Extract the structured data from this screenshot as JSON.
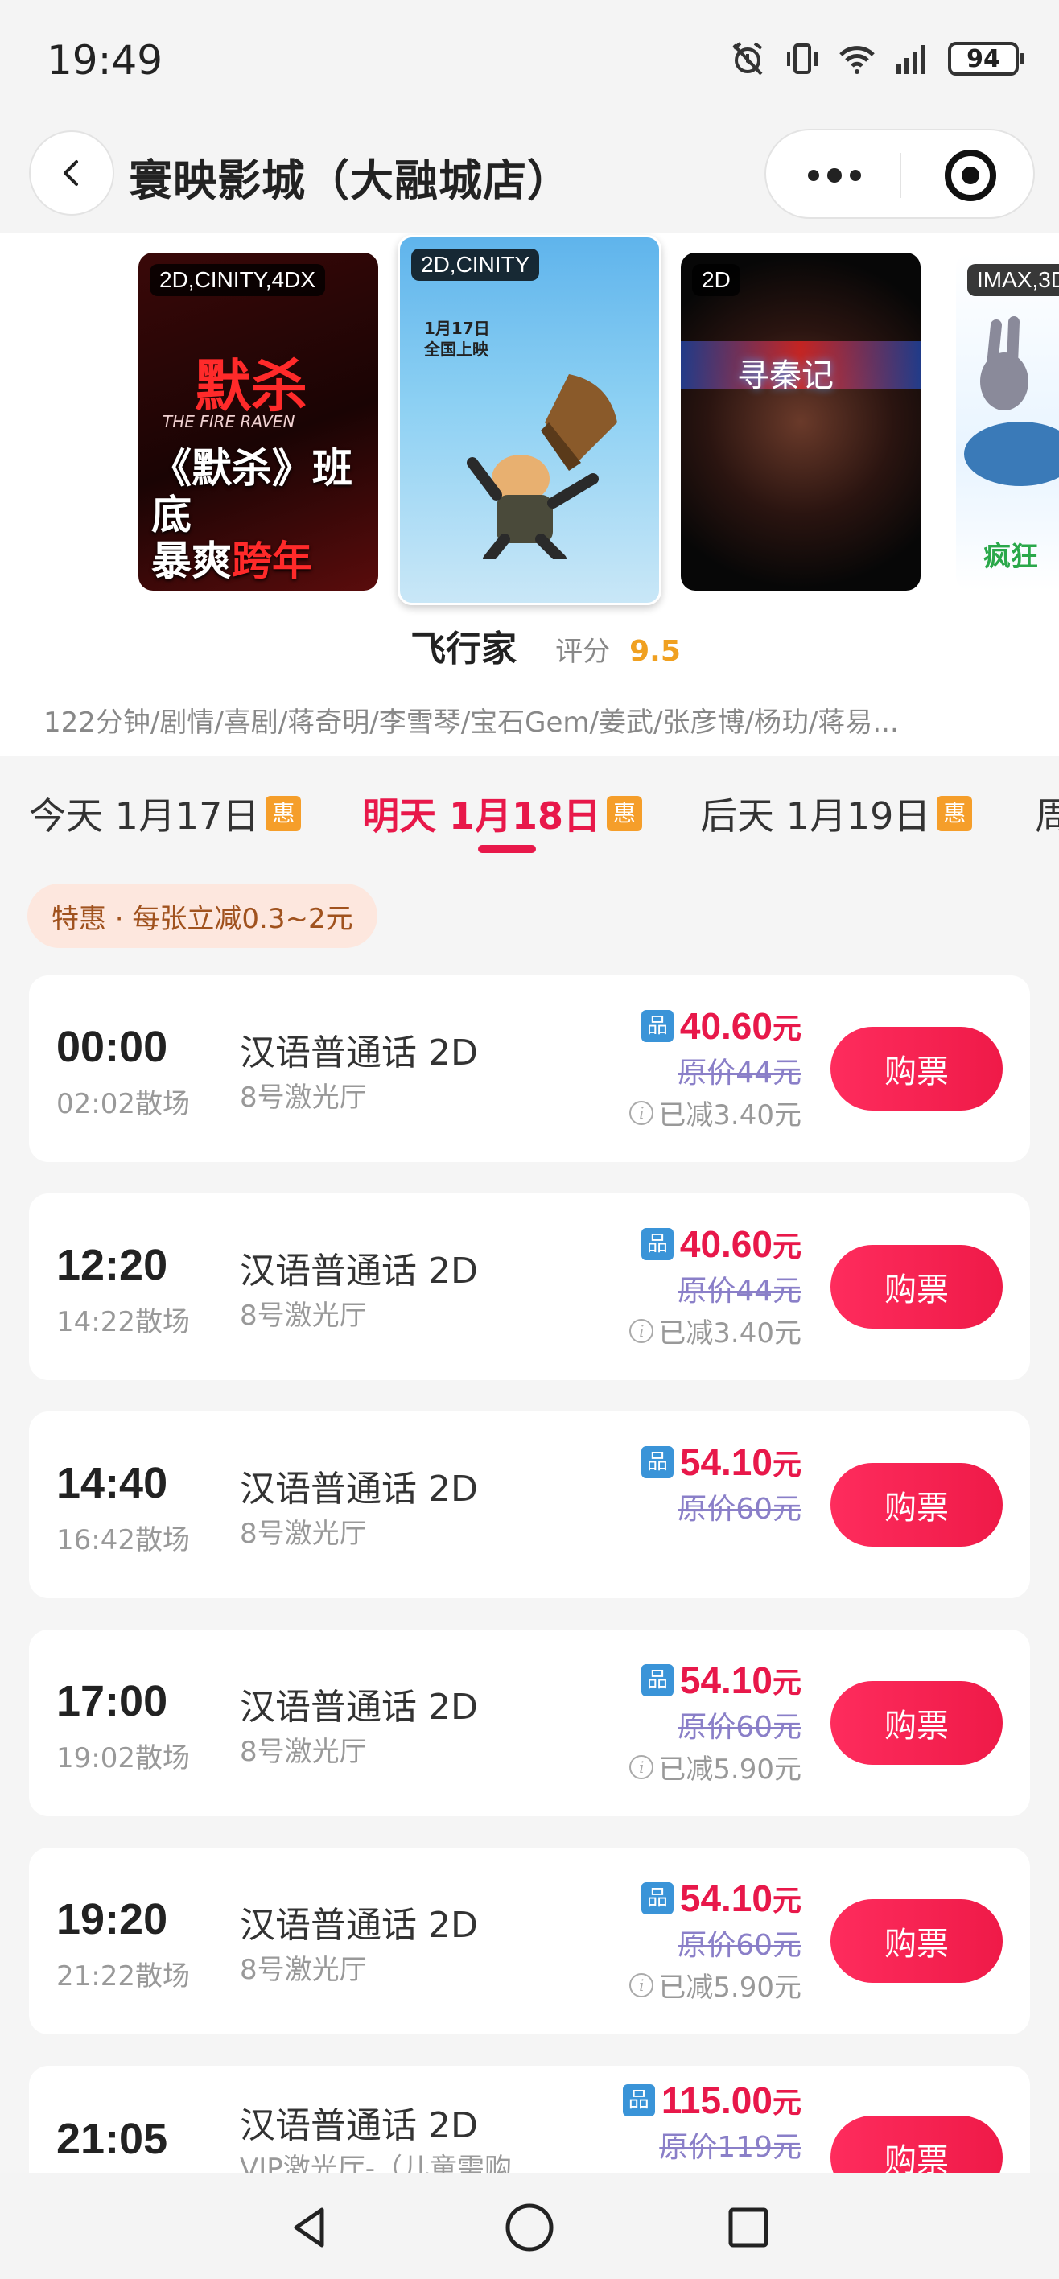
{
  "status_bar": {
    "time": "19:49",
    "battery": "94",
    "icons": [
      "alarm-icon",
      "vibrate-icon",
      "wifi-icon",
      "signal-icon",
      "battery-icon"
    ]
  },
  "header": {
    "title": "寰映影城（大融城店）",
    "back_icon": "chevron-left-icon",
    "more_icon": "more-dots-icon",
    "close_icon": "target-close-icon"
  },
  "posters": [
    {
      "tag": "2D,CINITY,4DX",
      "line1": "《默杀》班底",
      "line2a": "暴爽",
      "line2b": "跨年",
      "logo": "默杀",
      "subtitle": "THE FIRE RAVEN"
    },
    {
      "tag": "2D,CINITY",
      "date_line1": "1月17日",
      "date_line2": "全国上映"
    },
    {
      "tag": "2D",
      "title": "寻秦记"
    },
    {
      "tag": "IMAX,3D",
      "title": "疯狂"
    }
  ],
  "movie": {
    "title": "飞行家",
    "score_label": "评分",
    "score": "9.5",
    "meta": "122分钟/剧情/喜剧/蒋奇明/李雪琴/宝石Gem/姜武/张彦博/杨玏/蒋易..."
  },
  "date_tabs": [
    {
      "label": "今天 1月17日",
      "badge": "惠",
      "active": false
    },
    {
      "label": "明天 1月18日",
      "badge": "惠",
      "active": true
    },
    {
      "label": "后天 1月19日",
      "badge": "惠",
      "active": false
    },
    {
      "label": "周",
      "badge": "",
      "active": false
    }
  ],
  "promo": "特惠 · 每张立减0.3~2元",
  "showtimes": [
    {
      "start": "00:00",
      "end": "02:02散场",
      "lang": "汉语普通话 2D",
      "hall": "8号激光厅",
      "price": "40.60",
      "unit": "元",
      "original": "原价44元",
      "discount": "已减3.40元",
      "badge": "品",
      "buy": "购票"
    },
    {
      "start": "12:20",
      "end": "14:22散场",
      "lang": "汉语普通话 2D",
      "hall": "8号激光厅",
      "price": "40.60",
      "unit": "元",
      "original": "原价44元",
      "discount": "已减3.40元",
      "badge": "品",
      "buy": "购票"
    },
    {
      "start": "14:40",
      "end": "16:42散场",
      "lang": "汉语普通话 2D",
      "hall": "8号激光厅",
      "price": "54.10",
      "unit": "元",
      "original": "原价60元",
      "discount": "",
      "badge": "品",
      "buy": "购票"
    },
    {
      "start": "17:00",
      "end": "19:02散场",
      "lang": "汉语普通话 2D",
      "hall": "8号激光厅",
      "price": "54.10",
      "unit": "元",
      "original": "原价60元",
      "discount": "已减5.90元",
      "badge": "品",
      "buy": "购票"
    },
    {
      "start": "19:20",
      "end": "21:22散场",
      "lang": "汉语普通话 2D",
      "hall": "8号激光厅",
      "price": "54.10",
      "unit": "元",
      "original": "原价60元",
      "discount": "已减5.90元",
      "badge": "品",
      "buy": "购票"
    },
    {
      "start": "21:05",
      "end": "",
      "lang": "汉语普通话 2D",
      "hall": "VIP激光厅-（儿童需购",
      "price": "115.00",
      "unit": "元",
      "original": "原价119元",
      "discount": "",
      "badge": "品",
      "buy": "购票"
    }
  ],
  "nav": {
    "back": "nav-back-icon",
    "home": "nav-home-icon",
    "recents": "nav-recents-icon"
  },
  "colors": {
    "accent": "#e8184a",
    "score": "#f0a020",
    "promo_bg": "#fde7de",
    "badge_blue": "#3a94d8",
    "hui_orange": "#f59e2a"
  }
}
